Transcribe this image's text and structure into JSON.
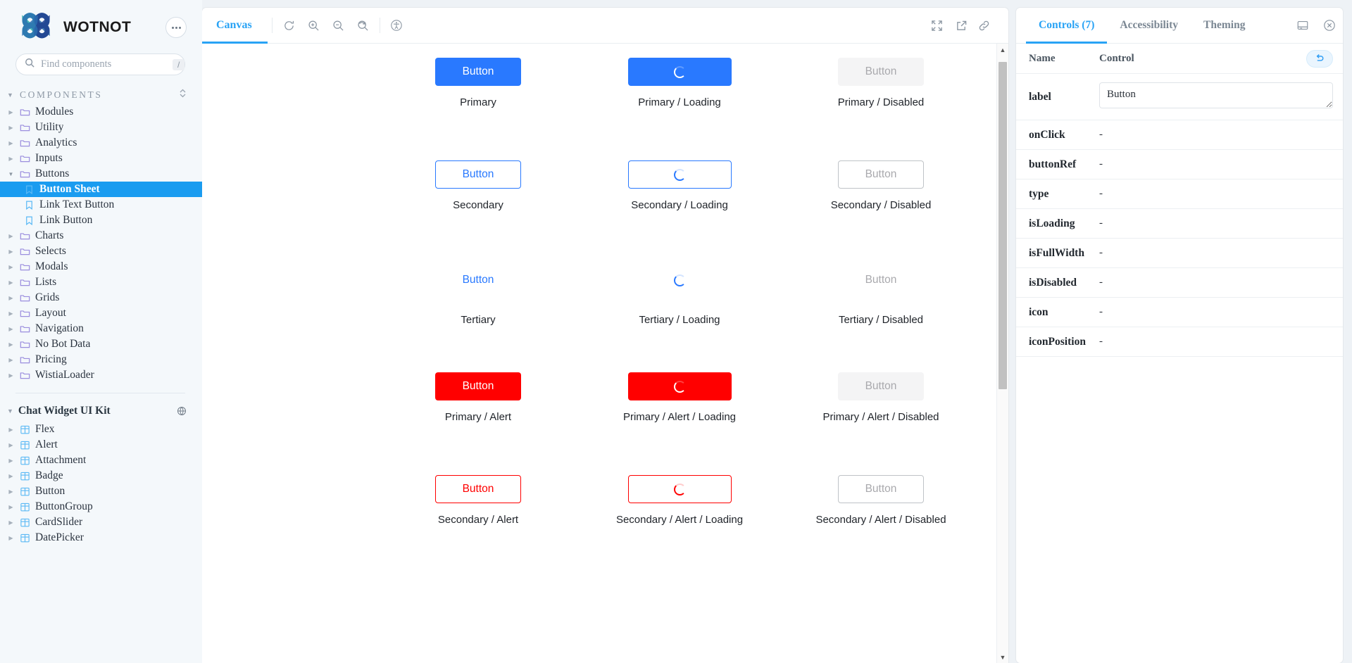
{
  "sidebar": {
    "brand": "WOTNOT",
    "more_label": "more-options",
    "search": {
      "value": "",
      "placeholder": "Find components",
      "shortcut": "/"
    },
    "components_section": {
      "label": "COMPONENTS"
    },
    "components": [
      {
        "label": "Modules",
        "icon": "folder-icon",
        "level": 0,
        "open": false,
        "selected": false
      },
      {
        "label": "Utility",
        "icon": "folder-icon",
        "level": 0,
        "open": false,
        "selected": false
      },
      {
        "label": "Analytics",
        "icon": "folder-icon",
        "level": 0,
        "open": false,
        "selected": false
      },
      {
        "label": "Inputs",
        "icon": "folder-icon",
        "level": 0,
        "open": false,
        "selected": false
      },
      {
        "label": "Buttons",
        "icon": "folder-icon",
        "level": 0,
        "open": true,
        "selected": false
      },
      {
        "label": "Button Sheet",
        "icon": "document-icon",
        "level": 1,
        "open": false,
        "selected": true
      },
      {
        "label": "Link Text Button",
        "icon": "document-icon",
        "level": 1,
        "open": false,
        "selected": false
      },
      {
        "label": "Link Button",
        "icon": "document-icon",
        "level": 1,
        "open": false,
        "selected": false
      },
      {
        "label": "Charts",
        "icon": "folder-icon",
        "level": 0,
        "open": false,
        "selected": false
      },
      {
        "label": "Selects",
        "icon": "folder-icon",
        "level": 0,
        "open": false,
        "selected": false
      },
      {
        "label": "Modals",
        "icon": "folder-icon",
        "level": 0,
        "open": false,
        "selected": false
      },
      {
        "label": "Lists",
        "icon": "folder-icon",
        "level": 0,
        "open": false,
        "selected": false
      },
      {
        "label": "Grids",
        "icon": "folder-icon",
        "level": 0,
        "open": false,
        "selected": false
      },
      {
        "label": "Layout",
        "icon": "folder-icon",
        "level": 0,
        "open": false,
        "selected": false
      },
      {
        "label": "Navigation",
        "icon": "folder-icon",
        "level": 0,
        "open": false,
        "selected": false
      },
      {
        "label": "No Bot Data",
        "icon": "folder-icon",
        "level": 0,
        "open": false,
        "selected": false
      },
      {
        "label": "Pricing",
        "icon": "folder-icon",
        "level": 0,
        "open": false,
        "selected": false
      },
      {
        "label": "WistiaLoader",
        "icon": "folder-icon",
        "level": 0,
        "open": false,
        "selected": false
      }
    ],
    "kit_section": {
      "label": "Chat Widget UI Kit",
      "icon": "globe-icon"
    },
    "kit_items": [
      {
        "label": "Flex",
        "icon": "component-icon"
      },
      {
        "label": "Alert",
        "icon": "component-icon"
      },
      {
        "label": "Attachment",
        "icon": "component-icon"
      },
      {
        "label": "Badge",
        "icon": "component-icon"
      },
      {
        "label": "Button",
        "icon": "component-icon"
      },
      {
        "label": "ButtonGroup",
        "icon": "component-icon"
      },
      {
        "label": "CardSlider",
        "icon": "component-icon"
      },
      {
        "label": "DatePicker",
        "icon": "component-icon"
      }
    ]
  },
  "toolbar": {
    "tab_label": "Canvas",
    "icons_left": [
      "reload-icon",
      "zoom-in-icon",
      "zoom-out-icon",
      "zoom-reset-icon",
      "accessibility-icon"
    ],
    "icons_right": [
      "fullscreen-icon",
      "open-external-icon",
      "copy-link-icon"
    ]
  },
  "canvas": {
    "items": [
      {
        "caption": "Primary",
        "variant": "primary",
        "label": "Button",
        "loading": false
      },
      {
        "caption": "Primary / Loading",
        "variant": "primary",
        "label": "",
        "loading": true
      },
      {
        "caption": "Primary / Disabled",
        "variant": "disabled",
        "label": "Button",
        "loading": false
      },
      {
        "caption": "Secondary",
        "variant": "secondary",
        "label": "Button",
        "loading": false
      },
      {
        "caption": "Secondary / Loading",
        "variant": "secondary",
        "label": "",
        "loading": true
      },
      {
        "caption": "Secondary / Disabled",
        "variant": "sec-disabled",
        "label": "Button",
        "loading": false
      },
      {
        "caption": "Tertiary",
        "variant": "tertiary",
        "label": "Button",
        "loading": false
      },
      {
        "caption": "Tertiary / Loading",
        "variant": "tertiary",
        "label": "",
        "loading": true
      },
      {
        "caption": "Tertiary / Disabled",
        "variant": "tertiary-disabled",
        "label": "Button",
        "loading": false
      },
      {
        "caption": "Primary / Alert",
        "variant": "alert",
        "label": "Button",
        "loading": false
      },
      {
        "caption": "Primary / Alert / Loading",
        "variant": "alert",
        "label": "",
        "loading": true
      },
      {
        "caption": "Primary / Alert / Disabled",
        "variant": "disabled",
        "label": "Button",
        "loading": false
      },
      {
        "caption": "Secondary / Alert",
        "variant": "sec-alert",
        "label": "Button",
        "loading": false
      },
      {
        "caption": "Secondary / Alert / Loading",
        "variant": "sec-alert",
        "label": "",
        "loading": true
      },
      {
        "caption": "Secondary / Alert / Disabled",
        "variant": "sec-disabled",
        "label": "Button",
        "loading": false
      }
    ]
  },
  "right_panel": {
    "tabs": [
      {
        "label": "Controls (7)",
        "active": true
      },
      {
        "label": "Accessibility",
        "active": false
      },
      {
        "label": "Theming",
        "active": false
      }
    ],
    "panel_icons": [
      "dock-bottom-icon",
      "close-icon"
    ],
    "table_headers": {
      "name": "Name",
      "control": "Control"
    },
    "reset_icon": "undo-icon",
    "rows": [
      {
        "name": "label",
        "type": "textarea",
        "value": "Button"
      },
      {
        "name": "onClick",
        "type": "text",
        "value": "-"
      },
      {
        "name": "buttonRef",
        "type": "text",
        "value": "-"
      },
      {
        "name": "type",
        "type": "text",
        "value": "-"
      },
      {
        "name": "isLoading",
        "type": "text",
        "value": "-"
      },
      {
        "name": "isFullWidth",
        "type": "text",
        "value": "-"
      },
      {
        "name": "isDisabled",
        "type": "text",
        "value": "-"
      },
      {
        "name": "icon",
        "type": "text",
        "value": "-"
      },
      {
        "name": "iconPosition",
        "type": "text",
        "value": "-"
      }
    ]
  },
  "colors": {
    "accent": "#29a3f5",
    "primary_button": "#2979ff",
    "alert": "#ff0000",
    "selected_row": "#1a9cf0",
    "sidebar_bg": "#f4f8fb"
  }
}
